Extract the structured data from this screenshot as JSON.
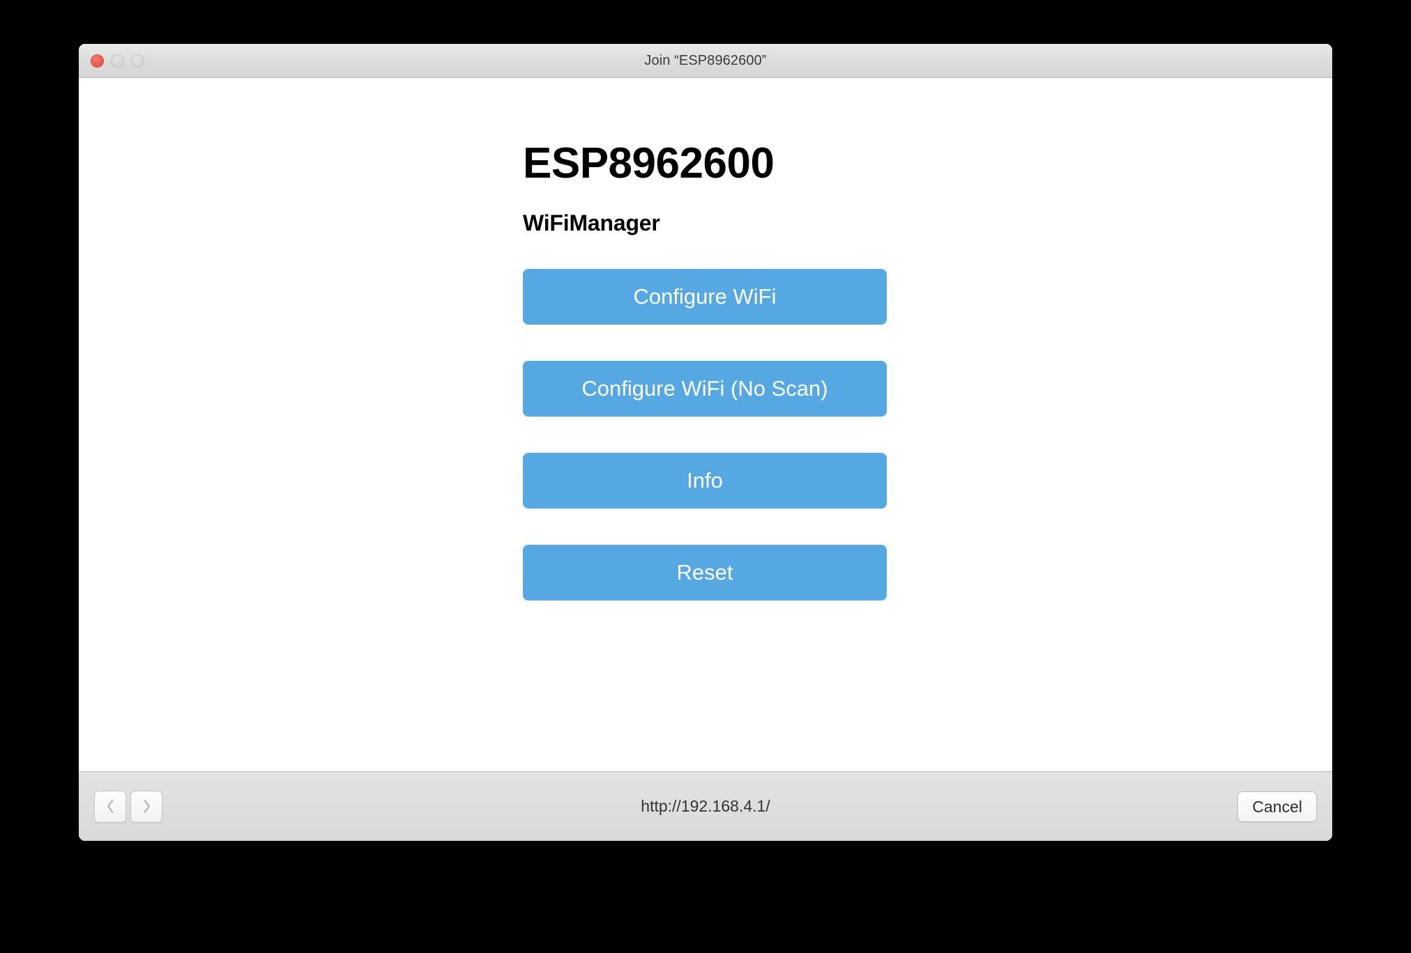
{
  "window": {
    "title": "Join “ESP8962600”",
    "traffic_lights": [
      {
        "name": "close",
        "color": "#e8584a"
      },
      {
        "name": "minimize",
        "color": "#d6d6d6"
      },
      {
        "name": "zoom",
        "color": "#d6d6d6"
      }
    ]
  },
  "page": {
    "heading": "ESP8962600",
    "subheading": "WiFiManager",
    "accent_color": "#55a8e2",
    "buttons": [
      {
        "label": "Configure WiFi"
      },
      {
        "label": "Configure WiFi (No Scan)"
      },
      {
        "label": "Info"
      },
      {
        "label": "Reset"
      }
    ]
  },
  "toolbar": {
    "back_icon": "chevron-left-icon",
    "forward_icon": "chevron-right-icon",
    "url": "http://192.168.4.1/",
    "cancel_label": "Cancel"
  }
}
